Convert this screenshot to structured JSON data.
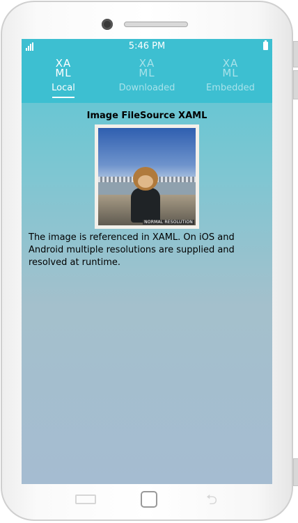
{
  "status_bar": {
    "time": "5:46 PM",
    "signal_icon": "signal-bars-icon",
    "battery_icon": "battery-icon"
  },
  "tabs": [
    {
      "icon_text": "XA\nML",
      "label": "Local",
      "selected": true
    },
    {
      "icon_text": "XA\nML",
      "label": "Downloaded",
      "selected": false
    },
    {
      "icon_text": "XA\nML",
      "label": "Embedded",
      "selected": false
    }
  ],
  "content": {
    "title": "Image FileSource XAML",
    "image_caption": "NORMAL RESOLUTION",
    "description": "The image is referenced in XAML. On iOS and Android multiple resolutions are supplied and resolved at runtime."
  },
  "nav_buttons": {
    "recent_icon": "recent-apps-icon",
    "home_icon": "home-icon",
    "back_icon": "back-arrow-icon"
  },
  "colors": {
    "accent": "#3dbfd1",
    "background_top": "#56c7d4",
    "background_bottom": "#a5bcd1"
  }
}
